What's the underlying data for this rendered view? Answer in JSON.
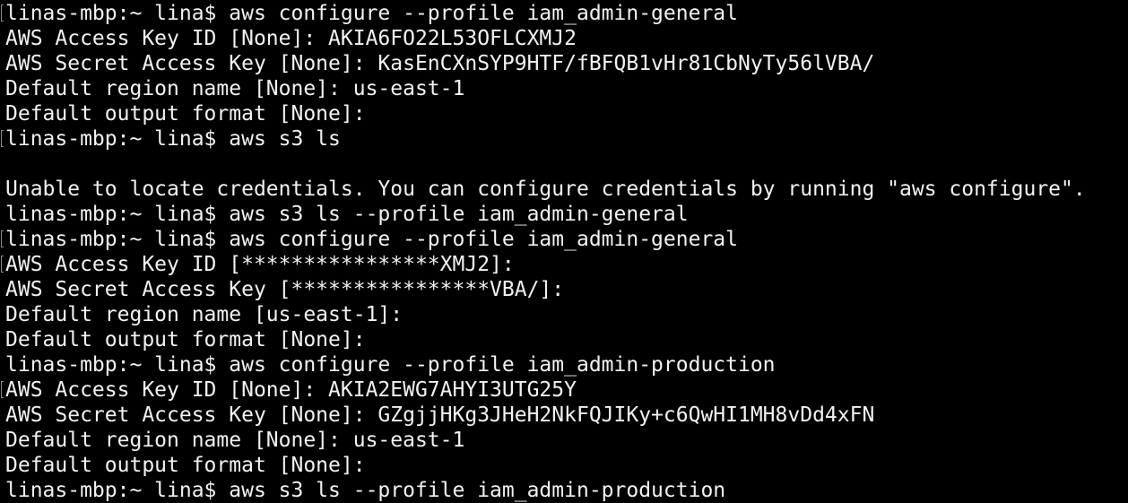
{
  "terminal": {
    "colors": {
      "background": "#000000",
      "text": "#f2f2f2",
      "mark": "#8a8a8a"
    },
    "lines": [
      {
        "text": "linas-mbp:~ lina$ aws configure --profile iam_admin-general",
        "marked": true
      },
      {
        "text": "AWS Access Key ID [None]: AKIA6FO22L53OFLCXMJ2",
        "marked": false
      },
      {
        "text": "AWS Secret Access Key [None]: KasEnCXnSYP9HTF/fBFQB1vHr81CbNyTy56lVBA/",
        "marked": false
      },
      {
        "text": "Default region name [None]: us-east-1",
        "marked": false
      },
      {
        "text": "Default output format [None]:",
        "marked": false
      },
      {
        "text": "linas-mbp:~ lina$ aws s3 ls",
        "marked": true
      },
      {
        "text": "",
        "marked": false
      },
      {
        "text": "Unable to locate credentials. You can configure credentials by running \"aws configure\".",
        "marked": false
      },
      {
        "text": "linas-mbp:~ lina$ aws s3 ls --profile iam_admin-general",
        "marked": false
      },
      {
        "text": "linas-mbp:~ lina$ aws configure --profile iam_admin-general",
        "marked": true
      },
      {
        "text": "AWS Access Key ID [****************XMJ2]:",
        "marked": true
      },
      {
        "text": "AWS Secret Access Key [****************VBA/]:",
        "marked": false
      },
      {
        "text": "Default region name [us-east-1]:",
        "marked": false
      },
      {
        "text": "Default output format [None]:",
        "marked": false
      },
      {
        "text": "linas-mbp:~ lina$ aws configure --profile iam_admin-production",
        "marked": false
      },
      {
        "text": "AWS Access Key ID [None]: AKIA2EWG7AHYI3UTG25Y",
        "marked": true
      },
      {
        "text": "AWS Secret Access Key [None]: GZgjjHKg3JHeH2NkFQJIKy+c6QwHI1MH8vDd4xFN",
        "marked": false
      },
      {
        "text": "Default region name [None]: us-east-1",
        "marked": false
      },
      {
        "text": "Default output format [None]:",
        "marked": false
      },
      {
        "text": "linas-mbp:~ lina$ aws s3 ls --profile iam_admin-production",
        "marked": false
      }
    ]
  }
}
